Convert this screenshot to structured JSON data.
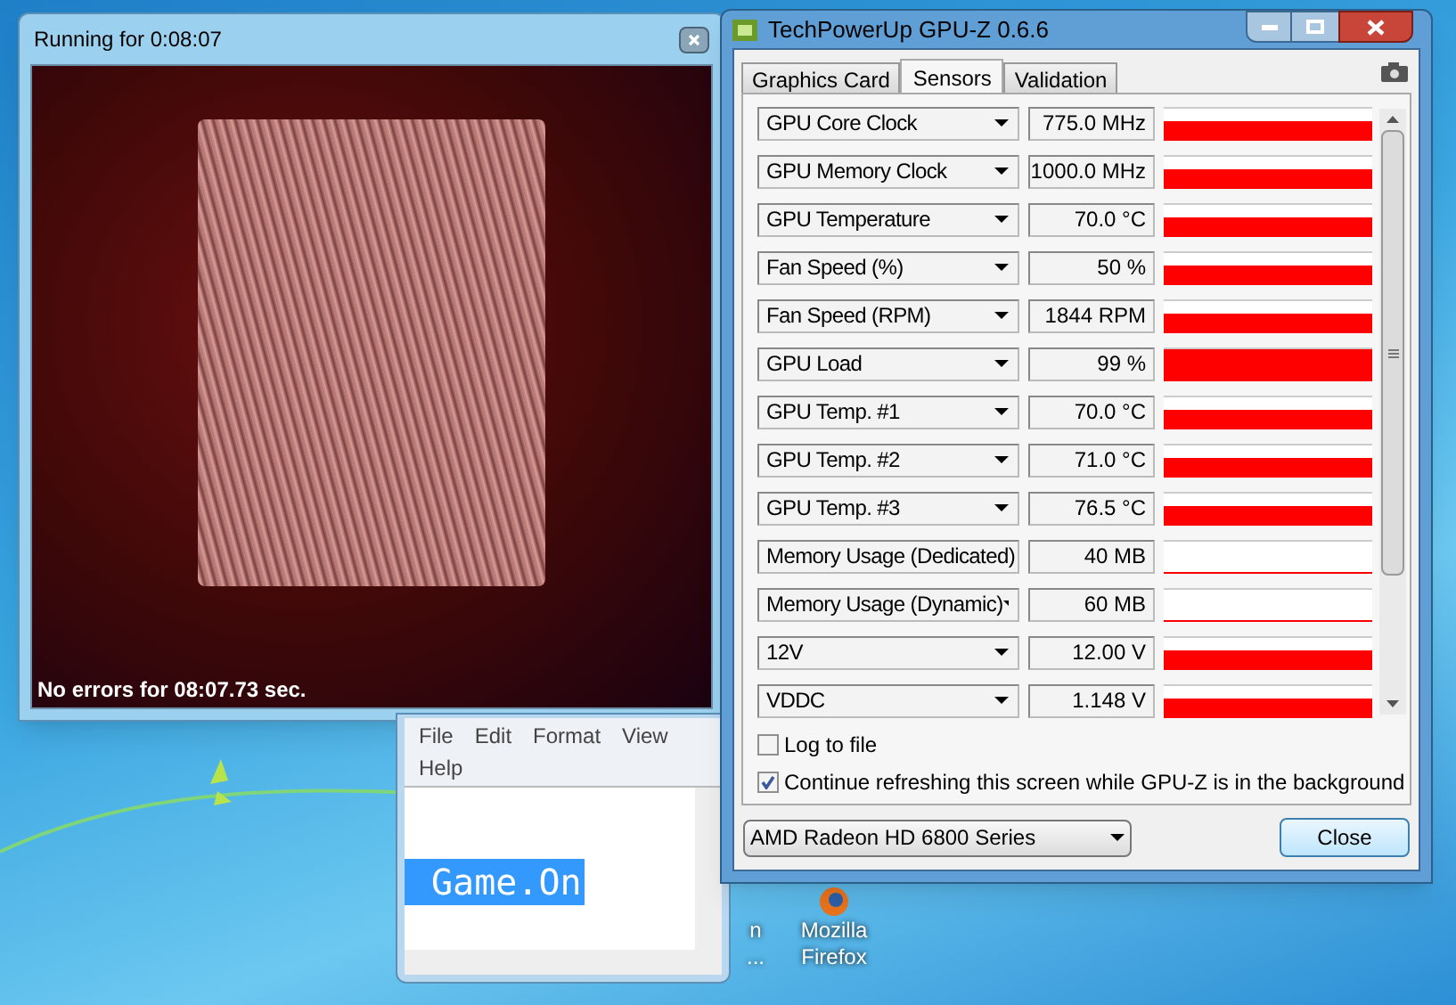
{
  "render_window": {
    "title": "Running for 0:08:07",
    "status": "No errors for 08:07.73 sec."
  },
  "notepad": {
    "menu": [
      "File",
      "Edit",
      "Format",
      "View",
      "Help"
    ],
    "text": "Game.On"
  },
  "gpuz": {
    "title": "TechPowerUp GPU-Z 0.6.6",
    "tabs": [
      {
        "label": "Graphics Card",
        "selected": false
      },
      {
        "label": "Sensors",
        "selected": true
      },
      {
        "label": "Validation",
        "selected": false
      }
    ],
    "sensors": [
      {
        "name": "GPU Core Clock",
        "value": "775.0 MHz",
        "kind": "partial"
      },
      {
        "name": "GPU Memory Clock",
        "value": "1000.0 MHz",
        "kind": "partial"
      },
      {
        "name": "GPU Temperature",
        "value": "70.0 °C",
        "kind": "partial"
      },
      {
        "name": "Fan Speed (%)",
        "value": "50 %",
        "kind": "partial"
      },
      {
        "name": "Fan Speed (RPM)",
        "value": "1844 RPM",
        "kind": "partial"
      },
      {
        "name": "GPU Load",
        "value": "99 %",
        "kind": "full"
      },
      {
        "name": "GPU Temp. #1",
        "value": "70.0 °C",
        "kind": "partial"
      },
      {
        "name": "GPU Temp. #2",
        "value": "71.0 °C",
        "kind": "partial"
      },
      {
        "name": "GPU Temp. #3",
        "value": "76.5 °C",
        "kind": "partial"
      },
      {
        "name": "Memory Usage (Dedicated)",
        "value": "40 MB",
        "kind": "empty"
      },
      {
        "name": "Memory Usage (Dynamic)",
        "value": "60 MB",
        "kind": "empty"
      },
      {
        "name": "12V",
        "value": "12.00 V",
        "kind": "partial"
      },
      {
        "name": "VDDC",
        "value": "1.148 V",
        "kind": "partial"
      }
    ],
    "options": [
      {
        "label": "Log to file",
        "checked": false
      },
      {
        "label": "Continue refreshing this screen while GPU-Z is in the background",
        "checked": true
      }
    ],
    "device": "AMD Radeon HD 6800 Series",
    "close": "Close"
  },
  "desktop_icons": [
    {
      "lines": [
        "n",
        "..."
      ]
    },
    {
      "lines": [
        "Mozilla",
        "Firefox"
      ]
    }
  ]
}
